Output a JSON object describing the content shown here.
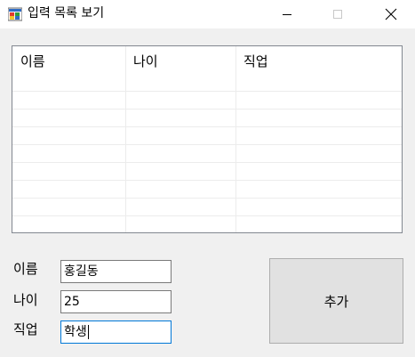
{
  "window": {
    "title": "입력 목록 보기",
    "icon": "app-window-icon",
    "controls": [
      "minimize-icon",
      "maximize-icon",
      "close-icon"
    ]
  },
  "list": {
    "columns": [
      "이름",
      "나이",
      "직업"
    ],
    "rows": []
  },
  "form": {
    "name_label": "이름",
    "name_value": "홍길동",
    "age_label": "나이",
    "age_value": "25",
    "job_label": "직업",
    "job_value": "학생"
  },
  "add_button": {
    "label": "추가"
  },
  "colors": {
    "focus_border": "#0078d7",
    "window_bg": "#f0f0f0",
    "button_bg": "#e1e1e1"
  }
}
